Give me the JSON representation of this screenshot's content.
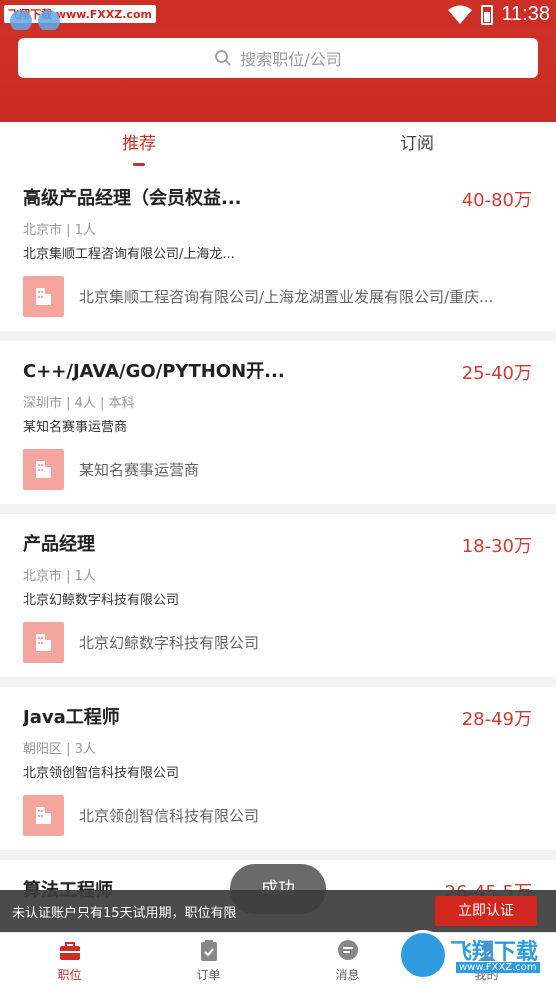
{
  "status_bar": {
    "watermark": "飞翔下载 www.FXXZ.com",
    "time": "11:38"
  },
  "search": {
    "placeholder": "搜索职位/公司"
  },
  "tabs": [
    {
      "label": "推荐",
      "active": true
    },
    {
      "label": "订阅",
      "active": false
    }
  ],
  "jobs": [
    {
      "title": "高级产品经理（会员权益...",
      "salary": "40-80万",
      "meta": "北京市 | 1人",
      "company_short": "北京集顺工程咨询有限公司/上海龙...",
      "company_full": "北京集顺工程咨询有限公司/上海龙湖置业发展有限公司/重庆..."
    },
    {
      "title": "C++/JAVA/GO/PYTHON开...",
      "salary": "25-40万",
      "meta": "深圳市 | 4人 | 本科",
      "company_short": "某知名赛事运营商",
      "company_full": "某知名赛事运营商"
    },
    {
      "title": "产品经理",
      "salary": "18-30万",
      "meta": "北京市 | 1人",
      "company_short": "北京幻鲸数字科技有限公司",
      "company_full": "北京幻鲸数字科技有限公司"
    },
    {
      "title": "Java工程师",
      "salary": "28-49万",
      "meta": "朝阳区 | 3人",
      "company_short": "北京领创智信科技有限公司",
      "company_full": "北京领创智信科技有限公司"
    },
    {
      "title": "算法工程师",
      "salary": "26-45.5万",
      "meta": "",
      "company_short": "",
      "company_full": ""
    }
  ],
  "toast": "成功",
  "notice": {
    "text": "未认证账户只有15天试用期，职位有限",
    "button": "立即认证"
  },
  "bottom_nav": [
    {
      "label": "职位",
      "icon": "briefcase-icon",
      "active": true
    },
    {
      "label": "订单",
      "icon": "clipboard-icon",
      "active": false
    },
    {
      "label": "消息",
      "icon": "chat-icon",
      "active": false
    },
    {
      "label": "我的",
      "icon": "user-icon",
      "active": false
    }
  ],
  "brand_watermark": {
    "text": "飞翔下载",
    "sub": "www.FXXZ.com"
  },
  "colors": {
    "primary": "#cc2f27",
    "salary": "#d33b32",
    "logo_bg": "#f3a59e"
  }
}
